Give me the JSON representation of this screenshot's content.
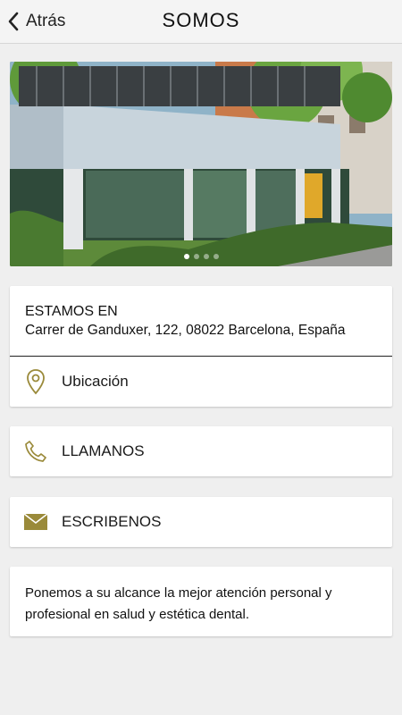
{
  "header": {
    "back_label": "Atrás",
    "title": "SOMOS"
  },
  "carousel": {
    "slide_count": 4,
    "active_index": 0
  },
  "location": {
    "heading": "ESTAMOS EN",
    "address": "Carrer de Ganduxer, 122, 08022 Barcelona, España",
    "map_label": "Ubicación"
  },
  "actions": {
    "call_label": "LLAMANOS",
    "mail_label": "ESCRIBENOS"
  },
  "about": {
    "text": "Ponemos a su alcance la mejor atención personal y profesional en salud y estética dental."
  },
  "colors": {
    "accent": "#9a8a3a",
    "background": "#efefef"
  }
}
